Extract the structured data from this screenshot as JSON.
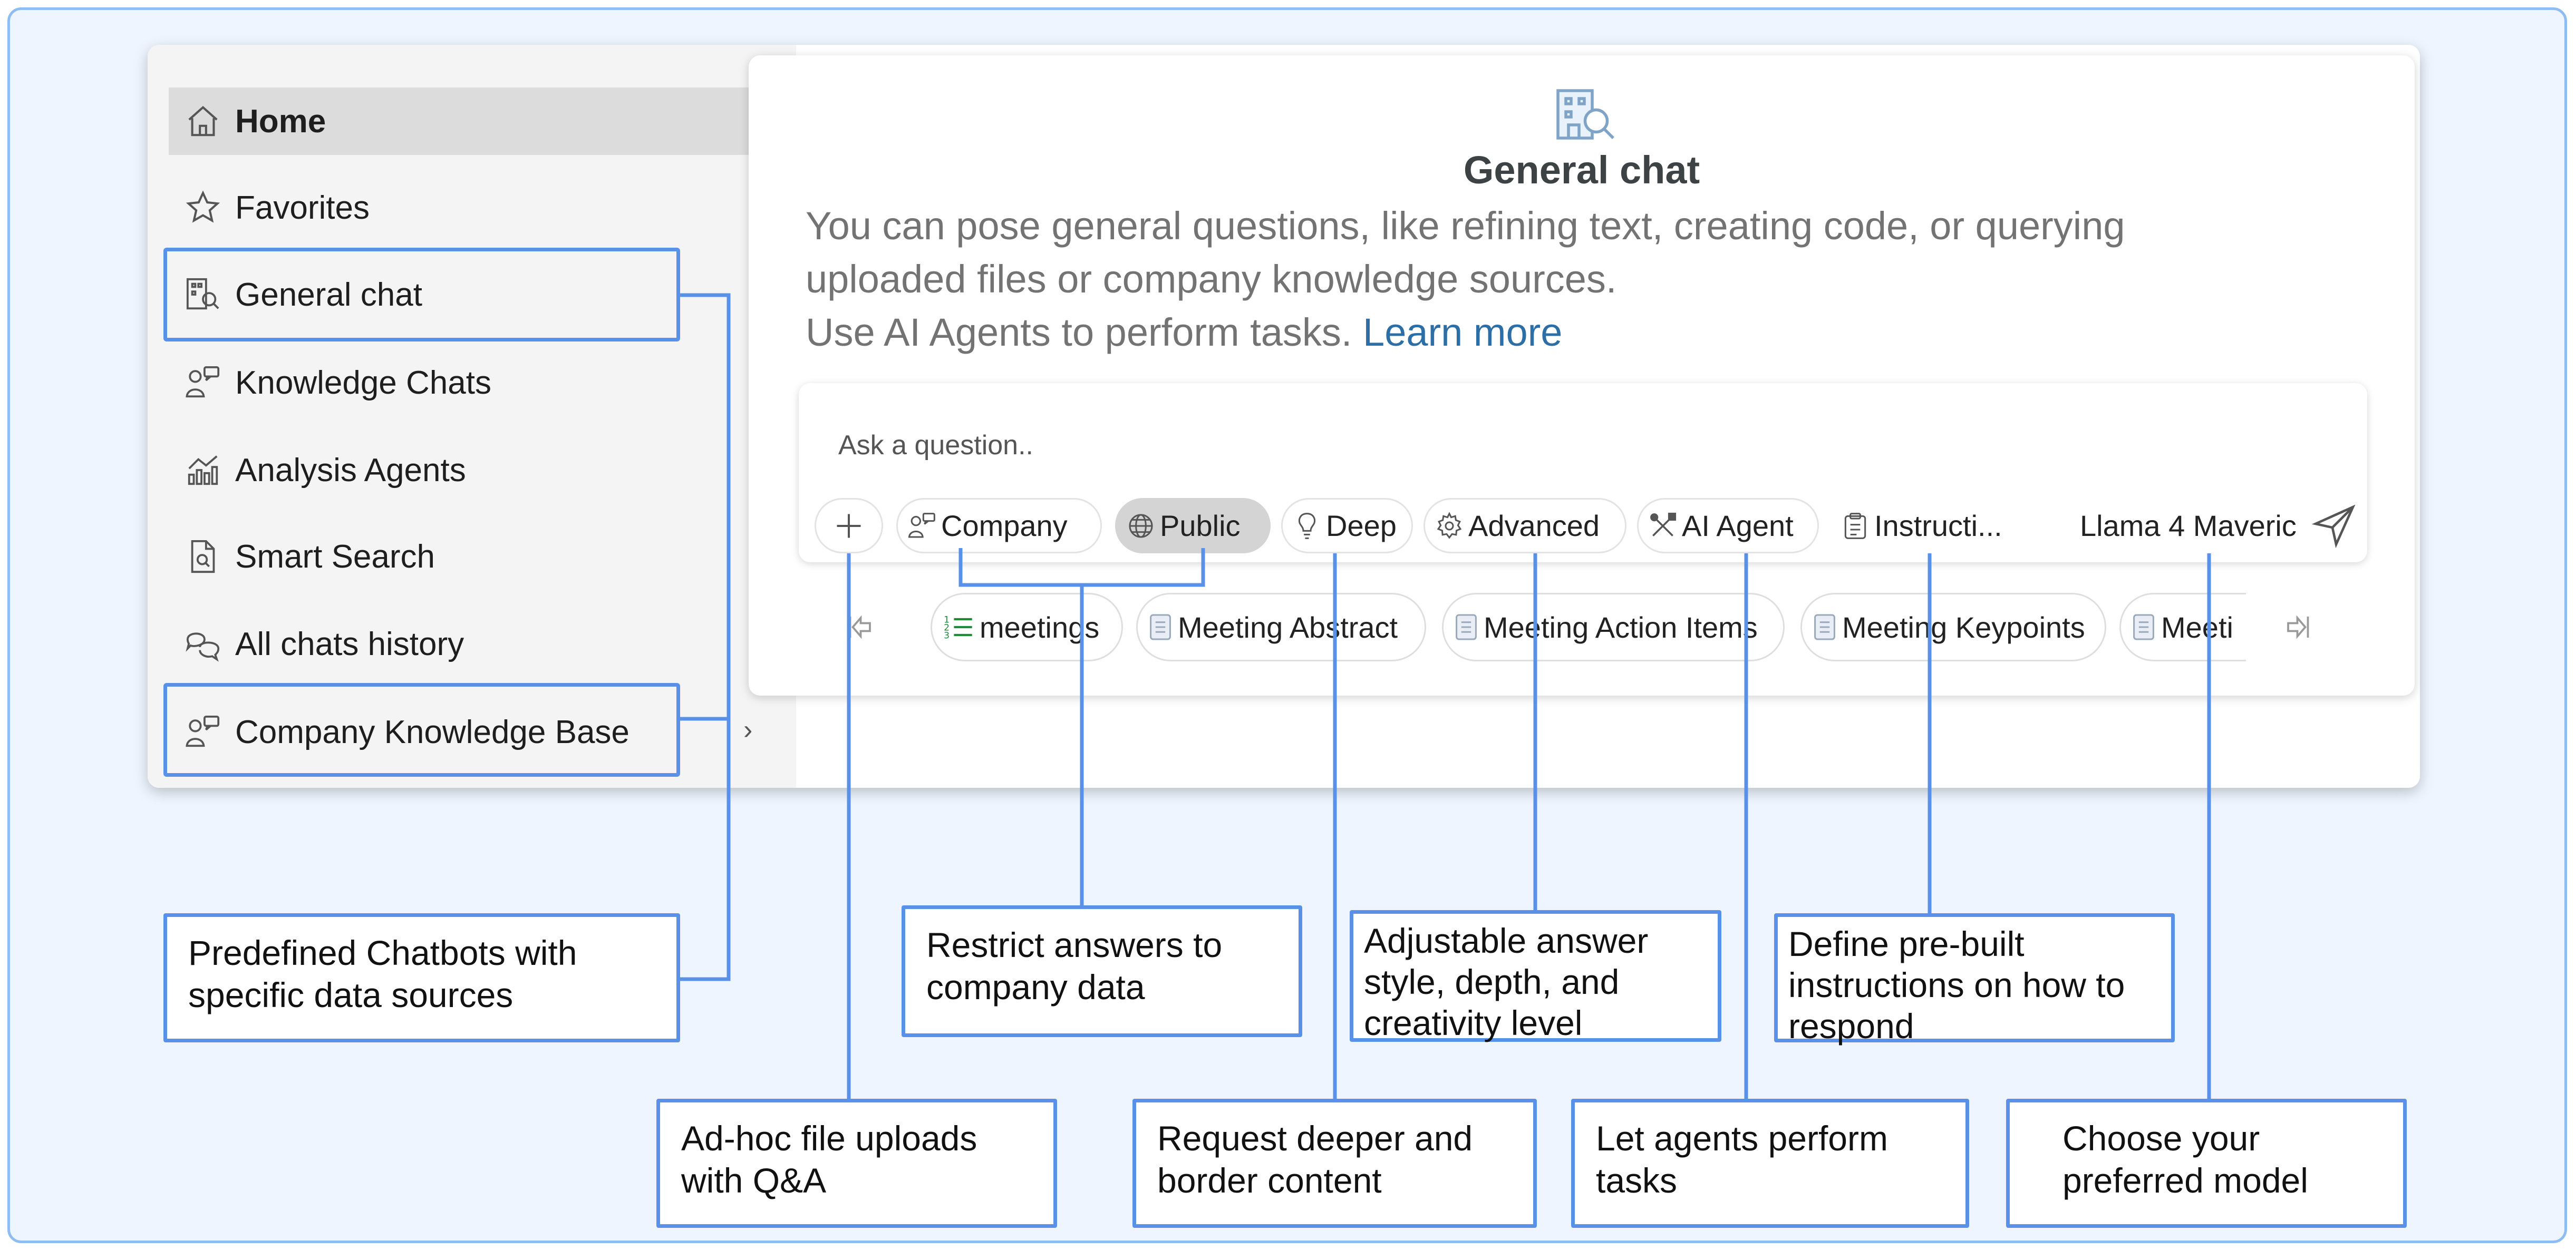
{
  "sidebar": {
    "items": [
      {
        "label": "Home",
        "icon": "home-icon"
      },
      {
        "label": "Favorites",
        "icon": "star-icon"
      },
      {
        "label": "General chat",
        "icon": "building-search-icon"
      },
      {
        "label": "Knowledge Chats",
        "icon": "people-chat-icon"
      },
      {
        "label": "Analysis Agents",
        "icon": "chart-icon"
      },
      {
        "label": "Smart Search",
        "icon": "file-search-icon"
      },
      {
        "label": "All chats history",
        "icon": "chat-bubbles-icon"
      },
      {
        "label": "Company Knowledge Base",
        "icon": "people-chat-icon"
      }
    ],
    "collapse_label": "›"
  },
  "chat": {
    "title": "General chat",
    "description_line1": "You can pose general questions, like refining text, creating code, or querying",
    "description_line2": "uploaded files or company knowledge sources.",
    "description_line3": "Use AI Agents to perform tasks.",
    "learn_more": "Learn more",
    "placeholder": "Ask a question..",
    "toolbar": {
      "company": "Company",
      "public": "Public",
      "deep": "Deep",
      "advanced": "Advanced",
      "ai_agent": "AI Agent",
      "instructions": "Instructi...",
      "model": "Llama 4 Maveric"
    },
    "suggestions": [
      "meetings",
      "Meeting Abstract",
      "Meeting Action Items",
      "Meeting Keypoints",
      "Meeti"
    ]
  },
  "callouts": {
    "chatbots": [
      "Predefined Chatbots with",
      "specific data sources"
    ],
    "restrict": [
      "Restrict answers to",
      "company data"
    ],
    "adjustable": [
      "Adjustable answer",
      "style, depth, and",
      "creativity level"
    ],
    "instructions": [
      "Define pre-built",
      "instructions on how to",
      "respond"
    ],
    "adhoc": [
      "Ad-hoc file uploads",
      "with Q&A"
    ],
    "deeper": [
      "Request deeper and",
      "border content"
    ],
    "agents": [
      "Let agents perform",
      "tasks"
    ],
    "model": [
      "Choose your",
      "preferred model"
    ]
  },
  "colors": {
    "accent": "#5a91e8",
    "frame_bg": "#eef5fe",
    "link": "#2c6ea6"
  }
}
